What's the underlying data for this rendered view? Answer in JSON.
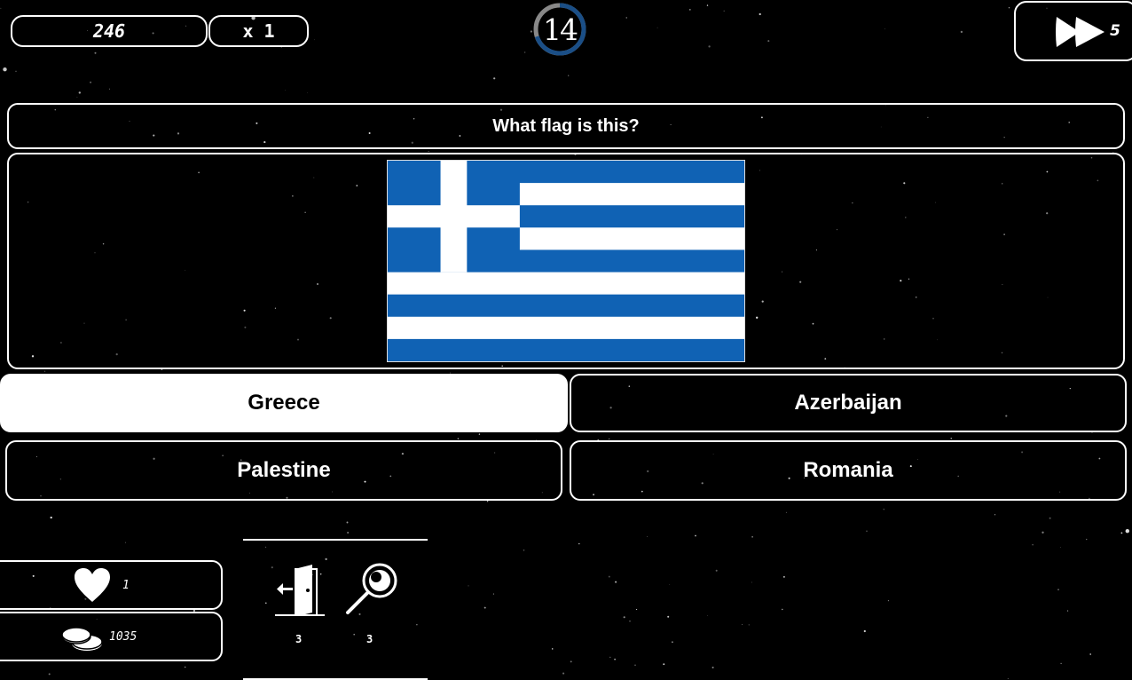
{
  "hud": {
    "score": "246",
    "multiplier": "x 1",
    "timer": "14",
    "timer_progress": 0.7,
    "skip_count": "5"
  },
  "question": {
    "text": "What flag is this?",
    "flag_colors": {
      "blue": "#1062B4",
      "white": "#FFFFFF"
    }
  },
  "answers": [
    {
      "label": "Greece",
      "selected": true
    },
    {
      "label": "Azerbaijan",
      "selected": false
    },
    {
      "label": "Palestine",
      "selected": false
    },
    {
      "label": "Romania",
      "selected": false
    }
  ],
  "stats": {
    "lives": "1",
    "coins": "1035"
  },
  "powerups": [
    {
      "icon": "exit-door-icon",
      "count": "3"
    },
    {
      "icon": "magnifier-icon",
      "count": "3"
    }
  ],
  "colors": {
    "accent_ring": "#1A4E86",
    "background": "#000000",
    "foreground": "#FFFFFF"
  }
}
